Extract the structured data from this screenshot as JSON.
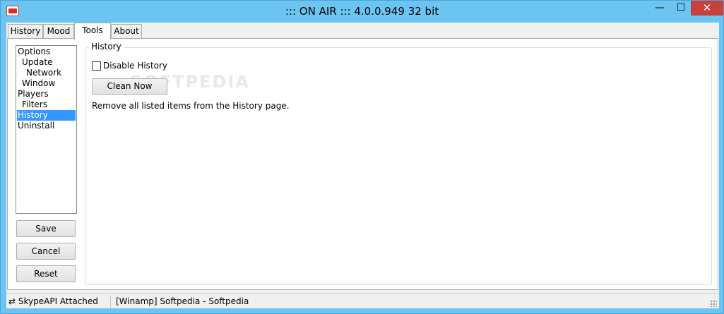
{
  "window": {
    "title": "::: ON AIR ::: 4.0.0.949 32 bit",
    "min_glyph": "—",
    "max_glyph": "☐",
    "close_glyph": "✕"
  },
  "tabs": [
    {
      "label": "History"
    },
    {
      "label": "Mood"
    },
    {
      "label": "Tools"
    },
    {
      "label": "About"
    }
  ],
  "active_tab": "Tools",
  "tree": {
    "items": [
      {
        "label": "Options"
      },
      {
        "label": "Update"
      },
      {
        "label": "Network"
      },
      {
        "label": "Window"
      },
      {
        "label": "Players"
      },
      {
        "label": "Filters"
      },
      {
        "label": "History"
      },
      {
        "label": "Uninstall"
      }
    ],
    "selected": "History"
  },
  "buttons": {
    "save": "Save",
    "cancel": "Cancel",
    "reset": "Reset"
  },
  "history_group": {
    "label": "History",
    "disable_label": "Disable History",
    "disable_checked": false,
    "clean_label": "Clean Now",
    "description": "Remove all listed items from the History page."
  },
  "watermark": "SOFTPEDIA",
  "status": {
    "skype_icon": "arrows-exchange-icon",
    "skype": "SkypeAPI Attached",
    "player": "[Winamp] Softpedia - Softpedia"
  },
  "colors": {
    "titlebar": "#6cc4f1",
    "selection": "#3399ff",
    "close": "#c7413a"
  }
}
